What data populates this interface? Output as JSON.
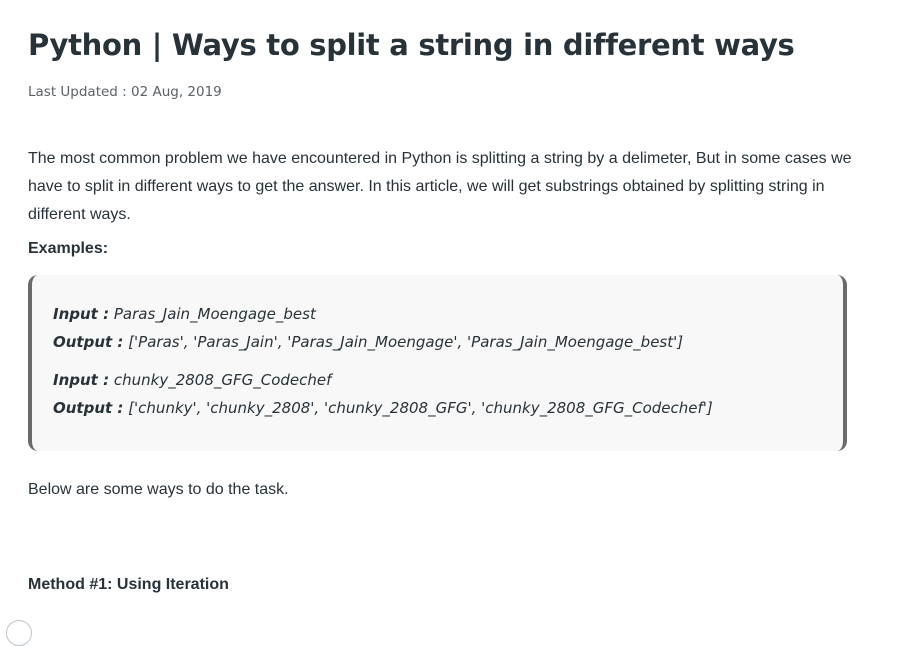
{
  "article": {
    "title": "Python | Ways to split a string in different ways",
    "last_updated": "Last Updated : 02 Aug, 2019",
    "intro": "The most common problem we have encountered in Python is splitting a string by a delimeter, But in some cases we have to split in different ways to get the answer. In this article, we will get substrings obtained by splitting string in different ways.",
    "examples_heading": "Examples:",
    "examples": [
      {
        "input_label": "Input :",
        "input_value": "Paras_Jain_Moengage_best",
        "output_label": "Output :",
        "output_value": "['Paras', 'Paras_Jain', 'Paras_Jain_Moengage', 'Paras_Jain_Moengage_best']"
      },
      {
        "input_label": "Input :",
        "input_value": "chunky_2808_GFG_Codechef",
        "output_label": "Output :",
        "output_value": "['chunky', 'chunky_2808', 'chunky_2808_GFG', 'chunky_2808_GFG_Codechef']"
      }
    ],
    "below_text": "Below are some ways to do the task.",
    "method_heading": "Method #1: Using Iteration"
  },
  "colors": {
    "text": "#273239",
    "muted": "#5a6268",
    "box_background": "#f8f8f8",
    "box_border": "#6b6b6b"
  }
}
